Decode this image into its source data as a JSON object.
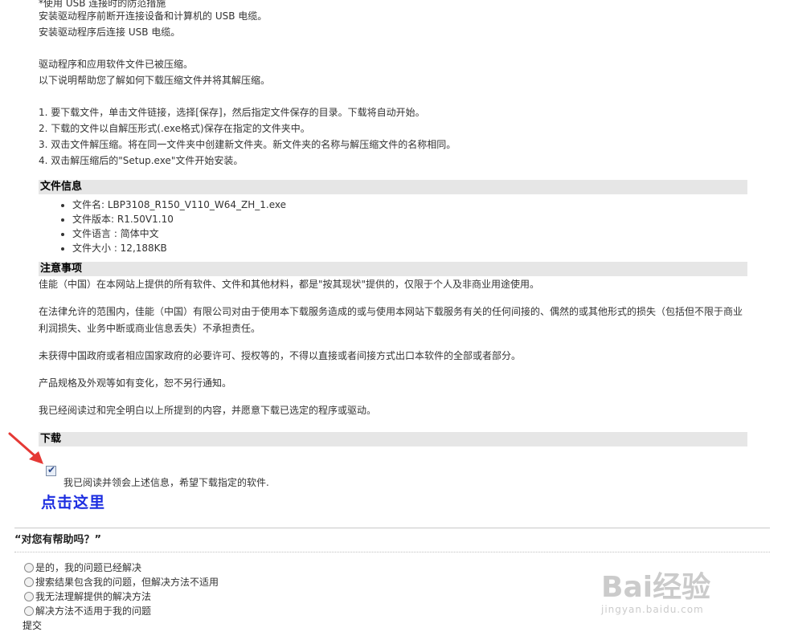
{
  "intro": {
    "lines": [
      "*使用 USB 连接时的防范措施",
      "安装驱动程序前断开连接设备和计算机的 USB 电缆。",
      "安装驱动程序后连接 USB 电缆。"
    ],
    "compress_lines": [
      "驱动程序和应用软件文件已被压缩。",
      "以下说明帮助您了解如何下载压缩文件并将其解压缩。"
    ],
    "steps": [
      "1. 要下载文件，单击文件链接，选择[保存]，然后指定文件保存的目录。下载将自动开始。",
      "2. 下载的文件以自解压形式(.exe格式)保存在指定的文件夹中。",
      "3. 双击文件解压缩。将在同一文件夹中创建新文件夹。新文件夹的名称与解压缩文件的名称相同。",
      "4. 双击解压缩后的\"Setup.exe\"文件开始安装。"
    ]
  },
  "file_info": {
    "header": "文件信息",
    "items": [
      "文件名: LBP3108_R150_V110_W64_ZH_1.exe",
      "文件版本: R1.50V1.10",
      "文件语言 : 简体中文",
      "文件大小 : 12,188KB"
    ]
  },
  "notice": {
    "header": "注意事项",
    "paragraphs": [
      "佳能（中国）在本网站上提供的所有软件、文件和其他材料，都是\"按其现状\"提供的，仅限于个人及非商业用途使用。",
      "在法律允许的范围内，佳能（中国）有限公司对由于使用本下载服务造成的或与使用本网站下载服务有关的任何间接的、偶然的或其他形式的损失（包括但不限于商业利润损失、业务中断或商业信息丢失）不承担责任。",
      "未获得中国政府或者相应国家政府的必要许可、授权等的，不得以直接或者间接方式出口本软件的全部或者部分。",
      "产品规格及外观等如有变化，恕不另行通知。",
      "我已经阅读过和完全明白以上所提到的内容，并愿意下载已选定的程序或驱动。"
    ]
  },
  "download": {
    "header": "下载",
    "agree_label": "我已阅读并领会上述信息，希望下载指定的软件.",
    "agree_checked": true,
    "link_label": "点击这里",
    "link_color": "#1d2ee0"
  },
  "feedback": {
    "title": "“对您有帮助吗？”",
    "options": [
      "是的，我的问题已经解决",
      "搜索结果包含我的问题，但解决方法不适用",
      "我无法理解提供的解决方法",
      "解决方法不适用于我的问题"
    ],
    "submit_label": "提交"
  },
  "watermark": {
    "brand": "Bai经验",
    "url": "jingyan.baidu.com"
  },
  "colors": {
    "section_bg": "#e6e6e6",
    "arrow": "#e53935"
  }
}
